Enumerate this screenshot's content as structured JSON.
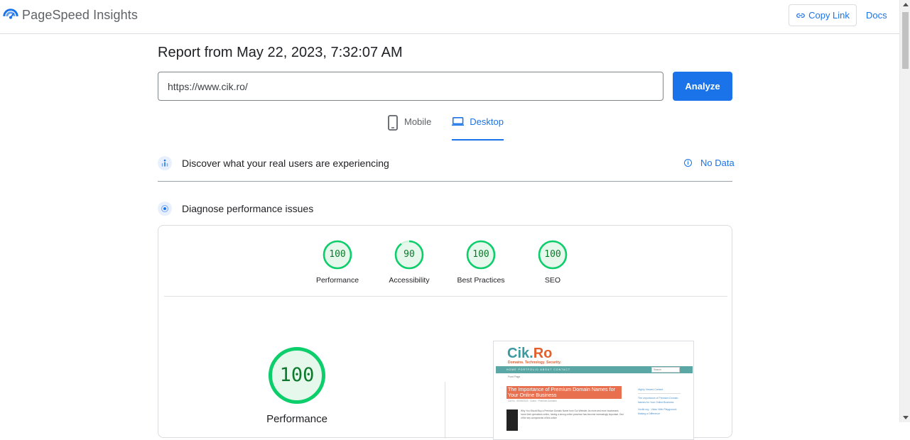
{
  "header": {
    "app_title": "PageSpeed Insights",
    "copy_link_label": "Copy Link",
    "docs_label": "Docs"
  },
  "report": {
    "title": "Report from May 22, 2023, 7:32:07 AM",
    "url_value": "https://www.cik.ro/",
    "analyze_label": "Analyze"
  },
  "tabs": [
    {
      "label": "Mobile",
      "icon": "phone-icon",
      "active": false
    },
    {
      "label": "Desktop",
      "icon": "laptop-icon",
      "active": true
    }
  ],
  "sections": {
    "real_users": {
      "label": "Discover what your real users are experiencing",
      "status": "No Data"
    },
    "diagnose": {
      "label": "Diagnose performance issues"
    }
  },
  "scores": [
    {
      "label": "Performance",
      "value": "100",
      "fraction": 1.0
    },
    {
      "label": "Accessibility",
      "value": "90",
      "fraction": 0.9
    },
    {
      "label": "Best Practices",
      "value": "100",
      "fraction": 1.0
    },
    {
      "label": "SEO",
      "value": "100",
      "fraction": 1.0
    }
  ],
  "main_score": {
    "label": "Performance",
    "value": "100",
    "fraction": 1.0
  },
  "screenshot": {
    "logo_cik": "Cik.",
    "logo_ro": "Ro",
    "tagline": "Domains. Technology. Security.",
    "nav": "HOME   PORTFOLIO   ABOUT   CONTACT",
    "search": "Search",
    "crumb": "Front Page",
    "headline": "The Importance of Premium Domain Names for Your Online Business",
    "meta": "Cik.Ro  ·  05/09/2023  ·  Guest  ·  Premium Domains",
    "body": "Why You Should Buy a Premium Domain Name from Our Website: As more and more businesses move their operations online, having a strong online presence has become increasingly important. One of the key components of this online",
    "side_heading": "Highly Viewed Content",
    "side_1": "The Importance of Premium Domain Names for Your Online Business",
    "side_2": "Vocile.org - Video Web Playground: Making a Difference"
  },
  "colors": {
    "accent": "#1a73e8",
    "pass_green": "#0cce6b",
    "pass_text": "#0c7a2c"
  }
}
